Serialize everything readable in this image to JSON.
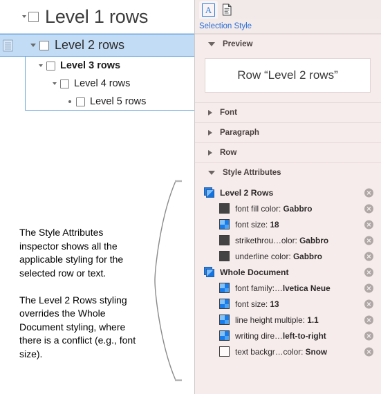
{
  "outline": {
    "rows": [
      {
        "label": "Level 1 rows",
        "level": 1,
        "disclosure": "open",
        "checkbox": true,
        "selected": false
      },
      {
        "label": "Level 2 rows",
        "level": 2,
        "disclosure": "open",
        "checkbox": true,
        "selected": true
      },
      {
        "label": "Level 3 rows",
        "level": 3,
        "disclosure": "open",
        "checkbox": true,
        "selected": false
      },
      {
        "label": "Level 4 rows",
        "level": 4,
        "disclosure": "open",
        "checkbox": true,
        "selected": false
      },
      {
        "label": "Level 5 rows",
        "level": 5,
        "disclosure": "bullet",
        "checkbox": true,
        "selected": false
      }
    ],
    "gutter_icon": "note-icon"
  },
  "annotation": {
    "paragraph1": "The Style Attributes inspector shows all the applicable styling for the selected row or text.",
    "paragraph2": "The Level 2 Rows styling overrides the Whole Document styling, where there is a conflict (e.g., font size)."
  },
  "inspector": {
    "tabs": [
      {
        "name": "text-inspector",
        "icon": "letter-a-icon",
        "selected": true
      },
      {
        "name": "document-inspector",
        "icon": "document-icon",
        "selected": false
      }
    ],
    "selection_label": "Selection Style",
    "accent_color": "#2a6fd6",
    "panel_bg": "#f6ecec",
    "sections": [
      {
        "key": "preview",
        "label": "Preview",
        "expanded": true
      },
      {
        "key": "font",
        "label": "Font",
        "expanded": false
      },
      {
        "key": "paragraph",
        "label": "Paragraph",
        "expanded": false
      },
      {
        "key": "row",
        "label": "Row",
        "expanded": false
      },
      {
        "key": "style_attributes",
        "label": "Style Attributes",
        "expanded": true
      }
    ],
    "preview": {
      "text": "Row “Level 2 rows”"
    },
    "style_attributes": [
      {
        "group": "Level 2 Rows",
        "icon": "layers-icon",
        "items": [
          {
            "name": "font fill color: ",
            "value": "Gabbro",
            "icon": "color-swatch-icon",
            "swatch": "#444444"
          },
          {
            "name": "font size: ",
            "value": "18",
            "icon": "checker-icon"
          },
          {
            "name": "strikethrou…olor: ",
            "value": "Gabbro",
            "icon": "color-swatch-icon",
            "swatch": "#444444"
          },
          {
            "name": "underline color: ",
            "value": "Gabbro",
            "icon": "color-swatch-icon",
            "swatch": "#444444"
          }
        ]
      },
      {
        "group": "Whole Document",
        "icon": "layers-icon",
        "items": [
          {
            "name": "font family:…",
            "value": "lvetica Neue",
            "icon": "checker-icon"
          },
          {
            "name": "font size: ",
            "value": "13",
            "icon": "checker-icon"
          },
          {
            "name": "line height multiple: ",
            "value": "1.1",
            "icon": "checker-icon"
          },
          {
            "name": "writing dire…",
            "value": "left-to-right",
            "icon": "checker-icon"
          },
          {
            "name": "text backgr…color: ",
            "value": "Snow",
            "icon": "color-swatch-icon",
            "swatch": "#fffafa"
          }
        ]
      }
    ],
    "delete_button_label": "remove-attribute"
  }
}
